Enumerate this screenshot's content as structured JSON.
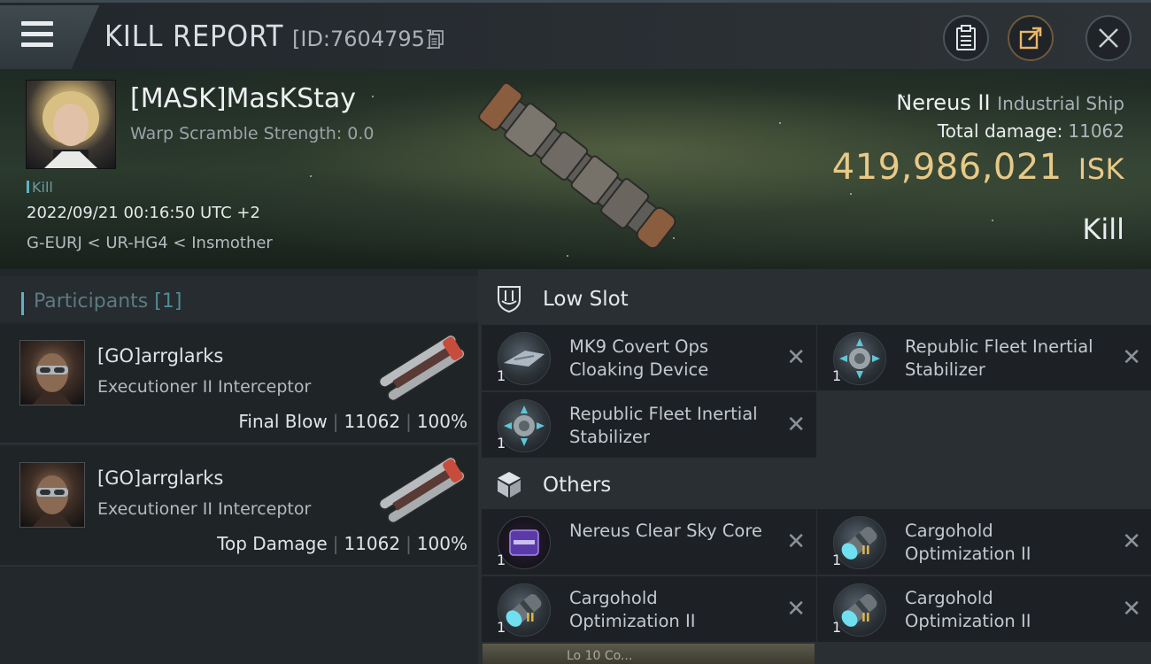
{
  "header": {
    "title": "KILL REPORT",
    "report_id": "[ID:7604795]",
    "icons": [
      "menu-icon",
      "copy-icon",
      "clipboard-icon",
      "share-icon",
      "close-icon"
    ]
  },
  "victim": {
    "pilot": "[MASK]MasKStay",
    "warp_scramble": "Warp Scramble Strength: 0.0",
    "tag": "Kill",
    "datetime": "2022/09/21 00:16:50 UTC +2",
    "location": "G-EURJ < UR-HG4 < Insmother",
    "ship_name": "Nereus II",
    "ship_class": "Industrial Ship",
    "total_damage_label": "Total damage:",
    "total_damage": "11062",
    "isk_value": "419,986,021",
    "isk_unit": "ISK",
    "result": "Kill"
  },
  "participants": {
    "title": "Participants",
    "count": "[1]",
    "items": [
      {
        "name": "[GO]arrglarks",
        "ship": "Executioner II Interceptor",
        "role": "Final Blow",
        "damage": "11062",
        "percent": "100%"
      },
      {
        "name": "[GO]arrglarks",
        "ship": "Executioner II Interceptor",
        "role": "Top Damage",
        "damage": "11062",
        "percent": "100%"
      }
    ]
  },
  "fitting": {
    "low_slot": {
      "title": "Low Slot",
      "modules": [
        {
          "qty": "1",
          "name": "MK9 Covert Ops Cloaking Device"
        },
        {
          "qty": "1",
          "name": "Republic Fleet Inertial Stabilizer"
        },
        {
          "qty": "1",
          "name": "Republic Fleet Inertial Stabilizer"
        }
      ]
    },
    "others": {
      "title": "Others",
      "modules": [
        {
          "qty": "1",
          "name": "Nereus Clear Sky Core"
        },
        {
          "qty": "1",
          "name": "Cargohold Optimization II"
        },
        {
          "qty": "1",
          "name": "Cargohold Optimization II"
        },
        {
          "qty": "1",
          "name": "Cargohold Optimization II"
        }
      ]
    },
    "remove_glyph": "✕",
    "rank_badge": "II",
    "peek_text": "Lo 10 Co..."
  },
  "colors": {
    "accent_gold": "#e8c987",
    "accent_teal": "#5fb3c0",
    "rank_gold": "#e3b64a"
  }
}
